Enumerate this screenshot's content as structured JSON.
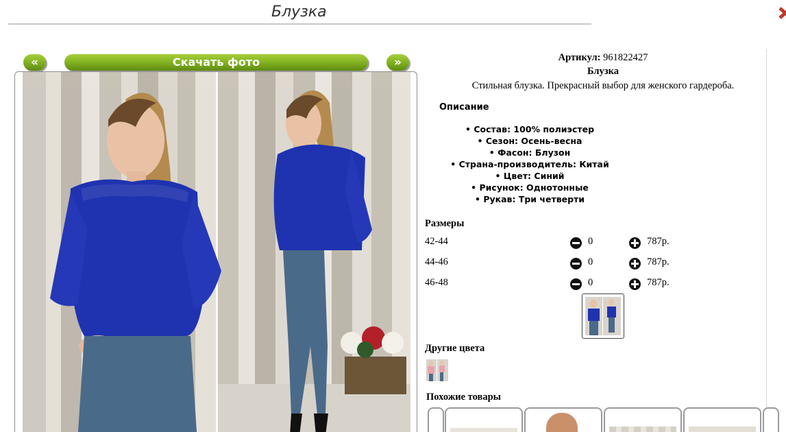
{
  "page": {
    "title": "Блузка"
  },
  "gallery": {
    "prev_label": "«",
    "download_label": "Скачать фото",
    "next_label": "»"
  },
  "product": {
    "sku_label": "Артикул:",
    "sku_value": "961822427",
    "name": "Блузка",
    "short_description": "Стильная блузка. Прекрасный выбор для женского гардероба.",
    "description_heading": "Описание",
    "attributes": [
      "Состав: 100% полиэстер",
      "Сезон: Осень-весна",
      "Фасон: Блузон",
      "Страна-производитель: Китай",
      "Цвет: Синий",
      "Рисунок: Однотонные",
      "Рукав: Три четверти"
    ]
  },
  "sizes": {
    "heading": "Размеры",
    "rows": [
      {
        "size": "42-44",
        "qty": "0",
        "price": "787р."
      },
      {
        "size": "44-46",
        "qty": "0",
        "price": "787р."
      },
      {
        "size": "46-48",
        "qty": "0",
        "price": "787р."
      }
    ]
  },
  "other_colors": {
    "heading": "Другие цвета"
  },
  "similar": {
    "heading": "Похожие товары"
  },
  "colors": {
    "button_green": "#86b523",
    "blouse_blue": "#1f33b0",
    "jeans": "#4a6a8a"
  }
}
